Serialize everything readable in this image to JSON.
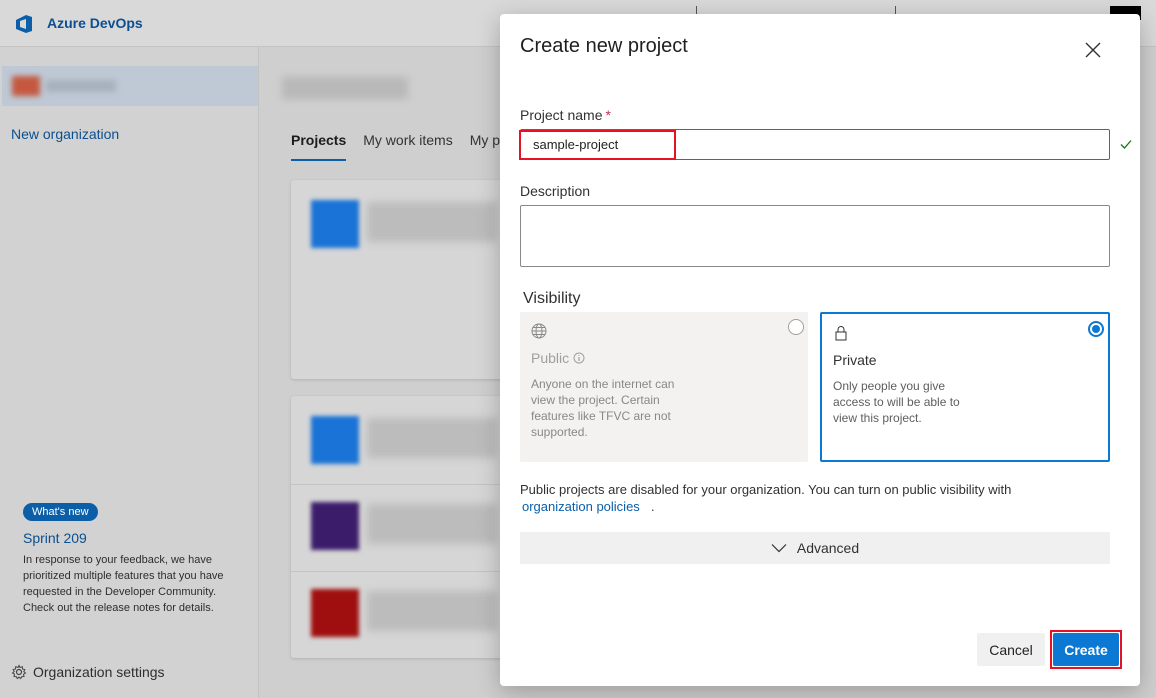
{
  "app": {
    "brand": "Azure DevOps",
    "new_organization": "New organization",
    "tabs": [
      "Projects",
      "My work items",
      "My p"
    ],
    "whats_new_badge": "What's new",
    "sprint_title": "Sprint 209",
    "release_note": "In response to your feedback, we have prioritized multiple features that you have requested in the Developer Community. Check out the release notes for details.",
    "org_settings": "Organization settings"
  },
  "dialog": {
    "title": "Create new project",
    "project_name_label": "Project name",
    "required_marker": "*",
    "project_name_value": "sample-project",
    "description_label": "Description",
    "description_value": "",
    "visibility_label": "Visibility",
    "public": {
      "name": "Public",
      "description": "Anyone on the internet can view the project. Certain features like TFVC are not supported."
    },
    "private": {
      "name": "Private",
      "description": "Only people you give access to will be able to view this project."
    },
    "selected_visibility": "Private",
    "public_note": "Public projects are disabled for your organization. You can turn on public visibility with",
    "org_policies_link": "organization policies",
    "period": ".",
    "advanced_label": "Advanced",
    "cancel_label": "Cancel",
    "create_label": "Create"
  },
  "colors": {
    "accent": "#0b78d4",
    "highlight": "#e81123",
    "valid_check": "#107c10"
  },
  "icons": [
    "azure-devops-logo-icon",
    "close-icon",
    "check-icon",
    "globe-icon",
    "info-icon",
    "lock-icon",
    "chevron-down-icon",
    "gear-icon"
  ]
}
